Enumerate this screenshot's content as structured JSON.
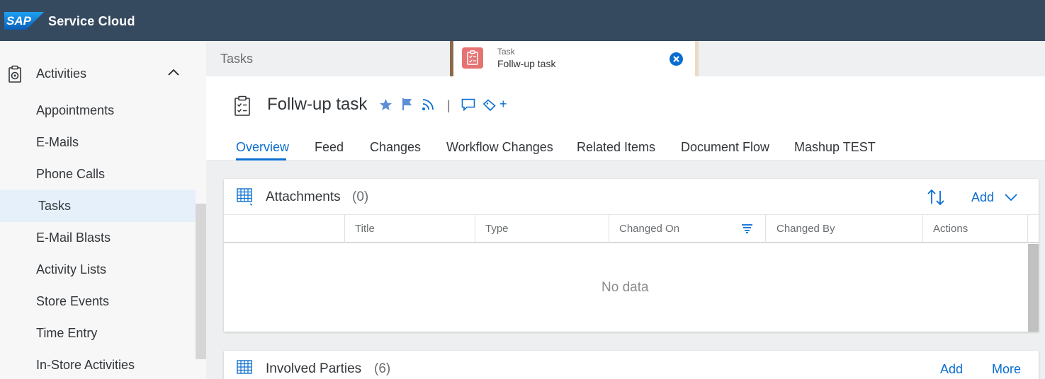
{
  "shell": {
    "logo_text": "SAP",
    "title": "Service Cloud"
  },
  "sidebar": {
    "group_label": "Activities",
    "items": [
      {
        "label": "Appointments"
      },
      {
        "label": "E-Mails"
      },
      {
        "label": "Phone Calls"
      },
      {
        "label": "Tasks",
        "active": true
      },
      {
        "label": "E-Mail Blasts"
      },
      {
        "label": "Activity Lists"
      },
      {
        "label": "Store Events"
      },
      {
        "label": "Time Entry"
      },
      {
        "label": "In-Store Activities"
      }
    ]
  },
  "tabstrip": {
    "list_tab": "Tasks",
    "doc_tab": {
      "type": "Task",
      "title": "Follw-up task"
    }
  },
  "object": {
    "title": "Follw-up task",
    "separator": "|",
    "add_tag_symbol": "+",
    "tabs": [
      {
        "label": "Overview",
        "active": true
      },
      {
        "label": "Feed"
      },
      {
        "label": "Changes"
      },
      {
        "label": "Workflow Changes"
      },
      {
        "label": "Related Items"
      },
      {
        "label": "Document Flow"
      },
      {
        "label": "Mashup TEST"
      }
    ]
  },
  "attachments": {
    "title": "Attachments",
    "count": "(0)",
    "add_label": "Add",
    "columns": [
      "Title",
      "Type",
      "Changed On",
      "Changed By",
      "Actions"
    ],
    "empty_text": "No data"
  },
  "involved_parties": {
    "title": "Involved Parties",
    "count": "(6)",
    "add_label": "Add",
    "more_label": "More"
  },
  "colors": {
    "shell": "#354a5f",
    "accent": "#0a6ed1",
    "active_item_bg": "#e5f0fa",
    "tab_icon": "#e57373"
  }
}
